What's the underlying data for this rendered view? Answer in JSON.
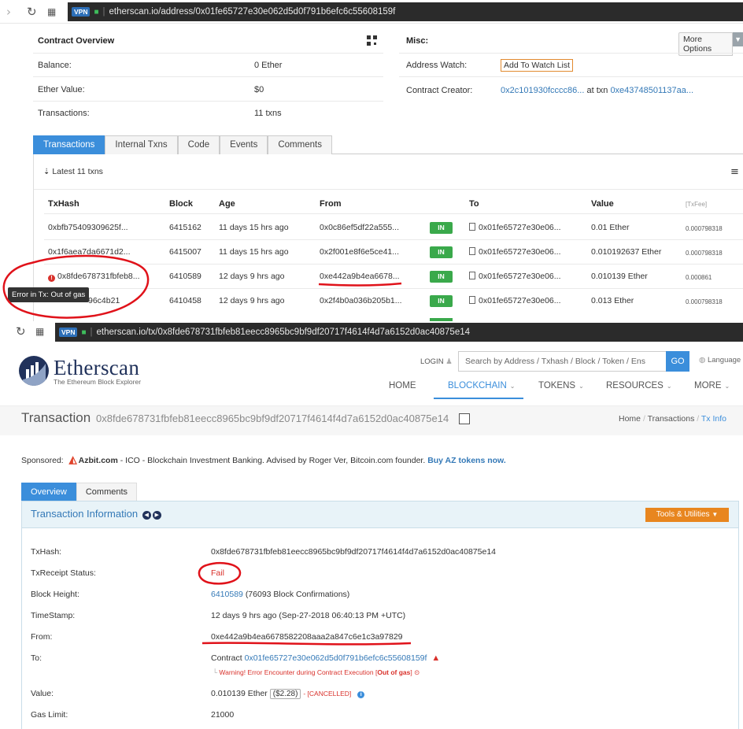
{
  "browser_top": {
    "vpn": "VPN",
    "url": "etherscan.io/address/0x01fe65727e30e062d5d0f791b6efc6c55608159f"
  },
  "overview": {
    "title": "Contract Overview",
    "balance_label": "Balance:",
    "balance_value": "0 Ether",
    "ether_value_label": "Ether Value:",
    "ether_value_value": "$0",
    "transactions_label": "Transactions:",
    "transactions_value": "11 txns"
  },
  "misc": {
    "title": "Misc:",
    "more_options": "More Options",
    "address_watch_label": "Address Watch:",
    "watch_button": "Add To Watch List",
    "creator_label": "Contract Creator:",
    "creator_address": "0x2c101930fcccc86...",
    "at_txn": "at txn",
    "creator_txn": "0xe43748501137aa..."
  },
  "tabs": [
    "Transactions",
    "Internal Txns",
    "Code",
    "Events",
    "Comments"
  ],
  "latest": "Latest 11 txns",
  "table": {
    "headers": {
      "hash": "TxHash",
      "block": "Block",
      "age": "Age",
      "from": "From",
      "to": "To",
      "value": "Value",
      "fee": "[TxFee]"
    },
    "rows": [
      {
        "hash": "0xbfb75409309625f...",
        "block": "6415162",
        "age": "11 days 15 hrs ago",
        "from": "0x0c86ef5df22a555...",
        "dir": "IN",
        "to": "0x01fe65727e30e06...",
        "value": "0.01 Ether",
        "fee": "0.000798318"
      },
      {
        "hash": "0x1f6aea7da6671d2...",
        "block": "6415007",
        "age": "11 days 15 hrs ago",
        "from": "0x2f001e8f6e5ce41...",
        "dir": "IN",
        "to": "0x01fe65727e30e06...",
        "value": "0.010192637 Ether",
        "fee": "0.000798318"
      },
      {
        "hash": "0x8fde678731fbfeb8...",
        "block": "6410589",
        "age": "12 days 9 hrs ago",
        "from": "0xe442a9b4ea6678...",
        "dir": "IN",
        "to": "0x01fe65727e30e06...",
        "value": "0.010139 Ether",
        "fee": "0.000861"
      },
      {
        "hash": "96c4b21",
        "block": "6410458",
        "age": "12 days 9 hrs ago",
        "from": "0x2f4b0a036b205b1...",
        "dir": "IN",
        "to": "0x01fe65727e30e06...",
        "value": "0.013 Ether",
        "fee": "0.000798318"
      }
    ],
    "tooltip": "Error in Tx: Out of gas"
  },
  "browser_bottom": {
    "vpn": "VPN",
    "url": "etherscan.io/tx/0x8fde678731fbfeb81eecc8965bc9bf9df20717f4614f4d7a6152d0ac40875e14"
  },
  "site": {
    "brand": "Etherscan",
    "tagline": "The Ethereum Block Explorer",
    "login": "LOGIN",
    "search_placeholder": "Search by Address / Txhash / Block / Token / Ens",
    "go": "GO",
    "language": "Language",
    "nav": [
      "HOME",
      "BLOCKCHAIN",
      "TOKENS",
      "RESOURCES",
      "MORE"
    ]
  },
  "page": {
    "title": "Transaction",
    "hash": "0x8fde678731fbfeb81eecc8965bc9bf9df20717f4614f4d7a6152d0ac40875e14",
    "crumbs": [
      "Home",
      "Transactions",
      "Tx Info"
    ]
  },
  "sponsor": {
    "label": "Sponsored:",
    "brand": "Azbit.com",
    "text": "- ICO - Blockchain Investment Banking. Advised by Roger Ver, Bitcoin.com founder.",
    "cta": "Buy AZ tokens now."
  },
  "detail_tabs": [
    "Overview",
    "Comments"
  ],
  "info": {
    "title": "Transaction Information",
    "tools": "Tools & Utilities",
    "txhash_label": "TxHash:",
    "txhash": "0x8fde678731fbfeb81eecc8965bc9bf9df20717f4614f4d7a6152d0ac40875e14",
    "status_label": "TxReceipt Status:",
    "status": "Fail",
    "block_label": "Block Height:",
    "block": "6410589",
    "confirmations": "(76093 Block Confirmations)",
    "time_label": "TimeStamp:",
    "time": "12 days 9 hrs ago (Sep-27-2018 06:40:13 PM +UTC)",
    "from_label": "From:",
    "from": "0xe442a9b4ea6678582208aaa2a847c6e1c3a97829",
    "to_label": "To:",
    "to_prefix": "Contract",
    "to": "0x01fe65727e30e062d5d0f791b6efc6c55608159f",
    "warning": "Warning! Error Encounter during Contract Execution [",
    "warning_bold": "Out of gas",
    "warning_end": "]",
    "value_label": "Value:",
    "value": "0.010139 Ether",
    "value_usd": "($2.28)",
    "cancelled": "- [CANCELLED]",
    "gaslimit_label": "Gas Limit:",
    "gaslimit": "21000"
  },
  "colors": {
    "accent": "#3b8edb",
    "link": "#3479b7",
    "success": "#3aa94b",
    "error": "#d9312b",
    "orange": "#e8861f",
    "brand_dark": "#21325b"
  }
}
